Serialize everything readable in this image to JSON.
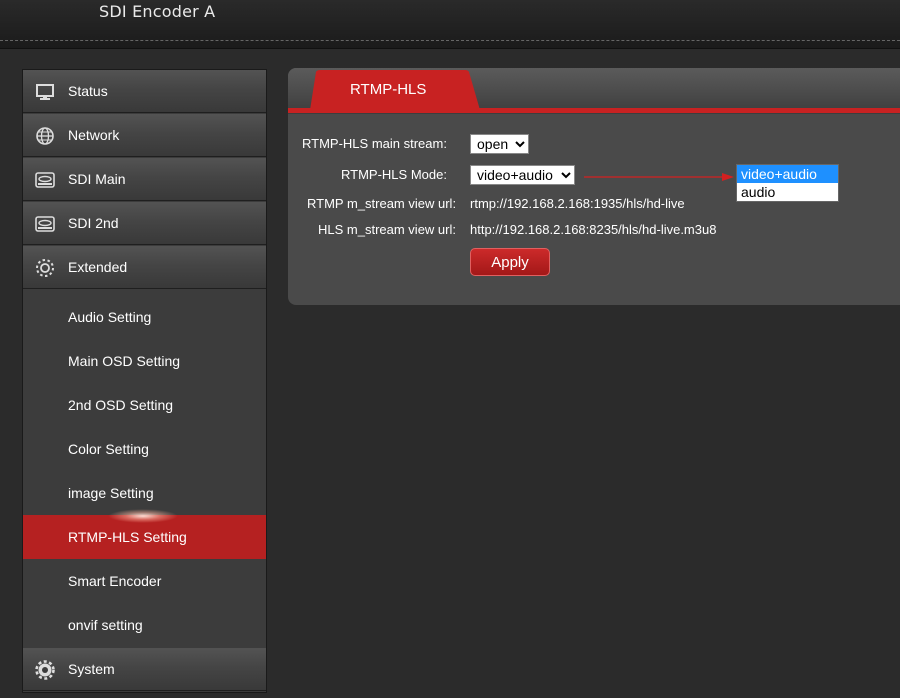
{
  "header": {
    "title": "SDI Encoder  A"
  },
  "sidebar": {
    "top_items": [
      {
        "label": "Status",
        "icon": "monitor-icon"
      },
      {
        "label": "Network",
        "icon": "globe-icon"
      },
      {
        "label": "SDI Main",
        "icon": "device-icon"
      },
      {
        "label": "SDI 2nd",
        "icon": "device-icon"
      },
      {
        "label": "Extended",
        "icon": "gear-icon"
      }
    ],
    "sub_items": [
      {
        "label": "Audio Setting"
      },
      {
        "label": "Main OSD Setting"
      },
      {
        "label": "2nd OSD Setting"
      },
      {
        "label": "Color Setting"
      },
      {
        "label": "image Setting"
      },
      {
        "label": "RTMP-HLS Setting",
        "active": true
      },
      {
        "label": "Smart Encoder"
      },
      {
        "label": "onvif setting"
      }
    ],
    "bottom_item": {
      "label": "System",
      "icon": "gear-icon"
    }
  },
  "panel": {
    "tab_label": "RTMP-HLS",
    "main_stream": {
      "label": "RTMP-HLS main stream:",
      "value": "open"
    },
    "mode": {
      "label": "RTMP-HLS Mode:",
      "value": "video+audio"
    },
    "rtmp_url": {
      "label": "RTMP m_stream view url:",
      "value": "rtmp://192.168.2.168:1935/hls/hd-live"
    },
    "hls_url": {
      "label": "HLS m_stream view url:",
      "value": "http://192.168.2.168:8235/hls/hd-live.m3u8"
    },
    "apply_label": "Apply"
  },
  "mode_dropdown": {
    "options": [
      "video+audio",
      "audio"
    ],
    "selected": "video+audio"
  },
  "colors": {
    "accent_red": "#c82222",
    "active_item": "#b52121",
    "selection_blue": "#1e90ff"
  }
}
